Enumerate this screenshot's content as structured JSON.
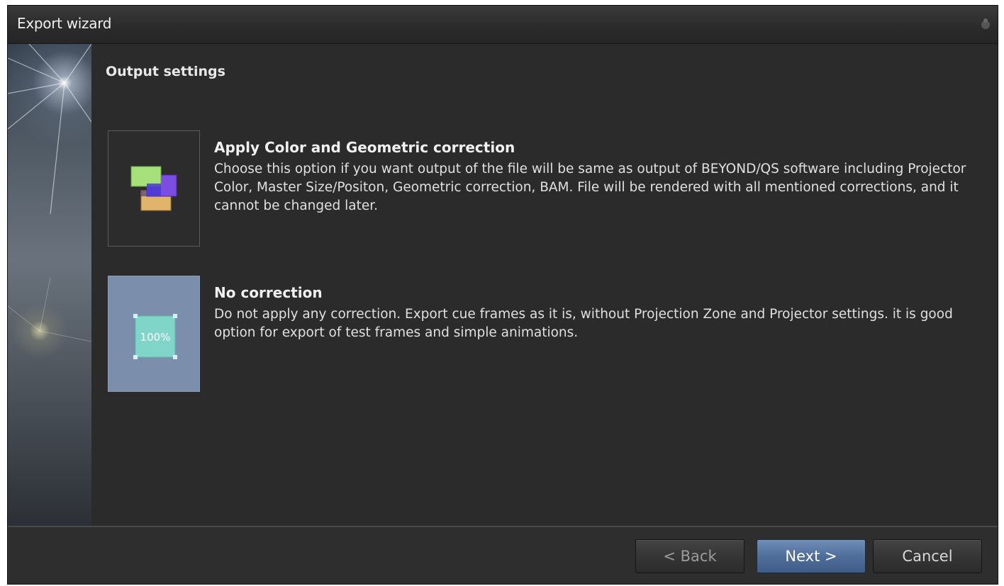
{
  "window": {
    "title": "Export wizard"
  },
  "page": {
    "section_title": "Output settings"
  },
  "options": [
    {
      "title": "Apply Color and Geometric correction",
      "description": "Choose this option if you want output of the file will be same as output of BEYOND/QS software including Projector Color, Master Size/Positon, Geometric correction, BAM. File will be rendered with all mentioned corrections, and it cannot be changed later.",
      "icon": "color-geometry-icon",
      "selected": false
    },
    {
      "title": "No correction",
      "description": "Do not apply any correction. Export cue frames as it is, without Projection Zone and Projector settings. it is good option for export of test frames and simple animations.",
      "icon": "scale-100-icon",
      "icon_text": "100%",
      "selected": true
    }
  ],
  "buttons": {
    "back": "< Back",
    "next": "Next >",
    "cancel": "Cancel"
  },
  "colors": {
    "background": "#2b2b2b",
    "accent": "#4f6e9a",
    "selected_option": "#7b8fad"
  }
}
